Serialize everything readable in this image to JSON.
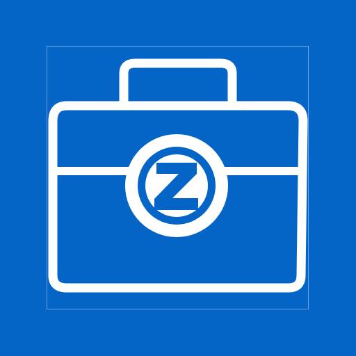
{
  "app_icon": {
    "name": "briefcase-z-icon",
    "letter": "Z",
    "colors": {
      "background": "#0565c6",
      "stroke": "#ffffff",
      "frame": "#bcd6f4"
    }
  }
}
